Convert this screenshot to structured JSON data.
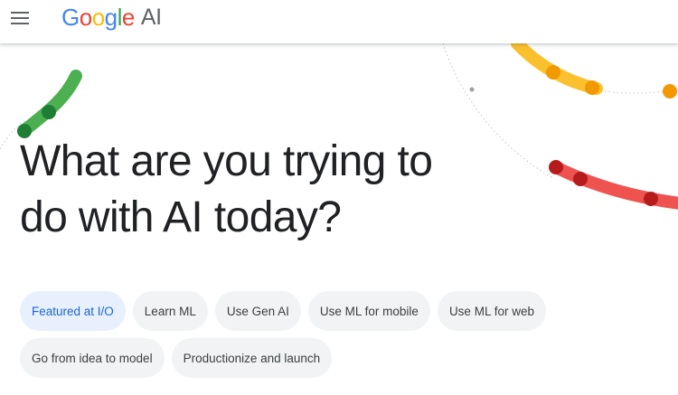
{
  "header": {
    "brand": {
      "letters": [
        "G",
        "o",
        "o",
        "g",
        "l",
        "e"
      ],
      "suffix": "AI"
    },
    "menu_icon": "hamburger-menu-icon"
  },
  "hero": {
    "title_line1": "What are you trying to",
    "title_line2": "do with AI today?"
  },
  "chips": {
    "row1": [
      {
        "label": "Featured at I/O",
        "selected": true
      },
      {
        "label": "Learn ML",
        "selected": false
      },
      {
        "label": "Use Gen AI",
        "selected": false
      },
      {
        "label": "Use ML for mobile",
        "selected": false
      },
      {
        "label": "Use ML for web",
        "selected": false
      }
    ],
    "row2": [
      {
        "label": "Go from idea to model",
        "selected": false
      },
      {
        "label": "Productionize and launch",
        "selected": false
      }
    ]
  },
  "colors": {
    "text": "#202124",
    "chip_bg": "#f1f3f4",
    "chip_active_bg": "#e8f0fe",
    "chip_active_text": "#1967d2",
    "green": "#4CAF50",
    "green_dark": "#1E7E34",
    "yellow": "#FBC02D",
    "orange": "#F29900",
    "red": "#EF5350",
    "red_dark": "#B71C1C"
  }
}
